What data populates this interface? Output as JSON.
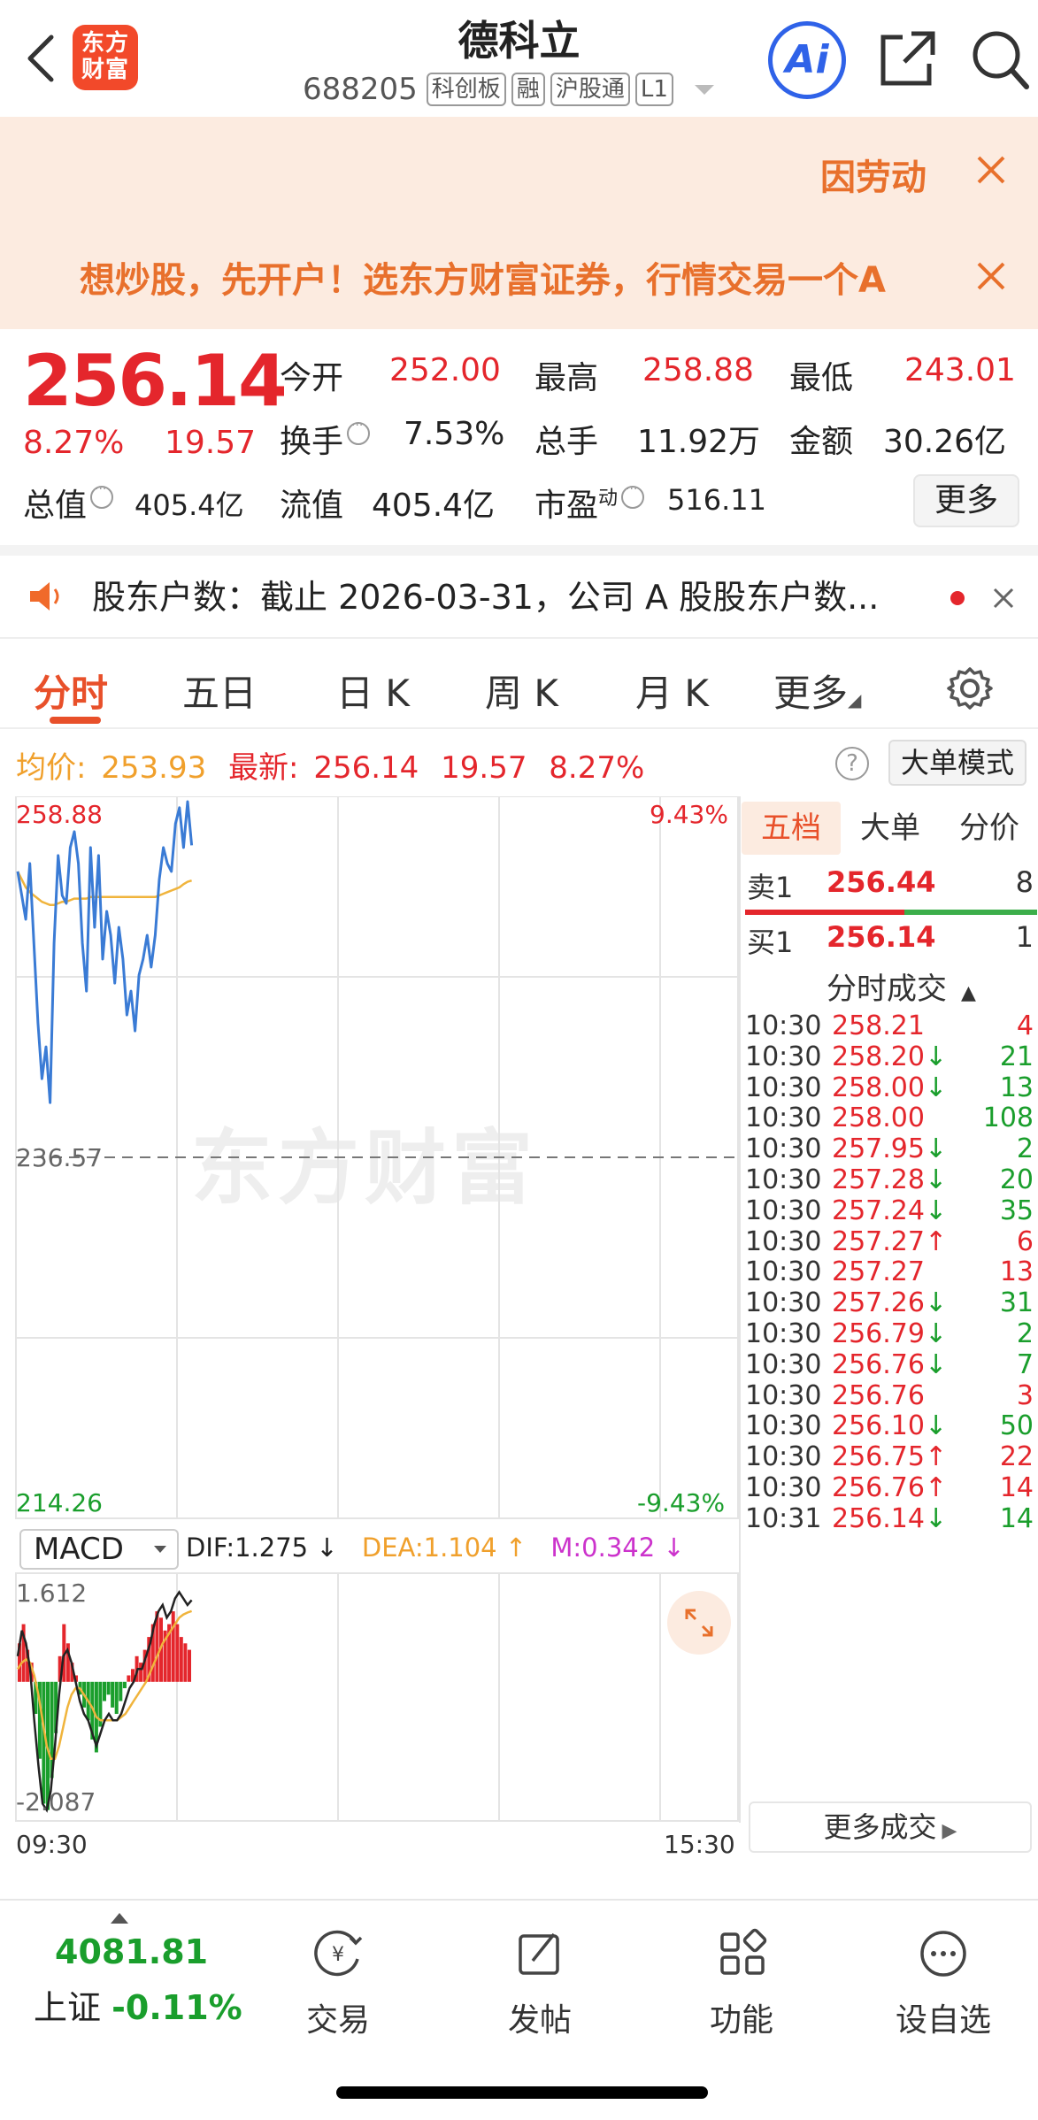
{
  "header": {
    "logo_text": "东方\n财富",
    "stock_name": "德科立",
    "stock_code": "688205",
    "tags": [
      "科创板",
      "融",
      "沪股通",
      "L1"
    ],
    "ai_label": "Ai"
  },
  "banners": {
    "banner1": "因劳动",
    "banner2": "想炒股，先开户！选东方财富证券，行情交易一个A"
  },
  "quote": {
    "price": "256.14",
    "change_pct": "8.27%",
    "change": "19.57",
    "open_label": "今开",
    "open": "252.00",
    "high_label": "最高",
    "high": "258.88",
    "low_label": "最低",
    "low": "243.01",
    "turnover_label": "换手",
    "turnover": "7.53%",
    "volume_label": "总手",
    "volume": "11.92万",
    "amount_label": "金额",
    "amount": "30.26亿",
    "mktcap_label": "总值",
    "mktcap": "405.4亿",
    "float_label": "流值",
    "float": "405.4亿",
    "pe_label": "市盈",
    "pe_sup": "动",
    "pe": "516.11",
    "more_label": "更多"
  },
  "notice": {
    "text": "股东户数：截止 2026-03-31，公司 A 股股东户数..."
  },
  "tabs": [
    "分时",
    "五日",
    "日 K",
    "周 K",
    "月 K",
    "更多"
  ],
  "chart_header": {
    "avg_label": "均价:",
    "avg": "253.93",
    "last_label": "最新:",
    "last": "256.14",
    "last_change": "19.57",
    "last_pct": "8.27%",
    "help_icon": "?",
    "mode_button": "大单模式"
  },
  "chart_data": {
    "type": "line",
    "title": "",
    "y_top": "258.88",
    "y_mid": "236.57",
    "y_bottom": "214.26",
    "pct_top": "9.43%",
    "pct_bottom": "-9.43%",
    "ylim": [
      214.26,
      258.88
    ],
    "x_start": "09:30",
    "x_end": "15:30",
    "watermark": "东方财富",
    "series": [
      {
        "values": [
          254.5,
          253.0,
          251.5,
          255.0,
          250.0,
          245.0,
          241.5,
          243.5,
          240.0,
          250.0,
          255.5,
          253.0,
          252.5,
          256.0,
          257.0,
          255.0,
          250.0,
          247.0,
          256.0,
          251.0,
          255.5,
          249.0,
          252.0,
          250.5,
          247.5,
          251.0,
          249.0,
          245.5,
          247.0,
          244.5,
          248.0,
          249.0,
          250.5,
          248.5,
          250.5,
          254.0,
          256.0,
          255.0,
          254.5,
          257.5,
          258.5,
          256.0,
          258.88,
          256.14
        ]
      },
      {
        "values": [
          254.5,
          254.0,
          253.5,
          253.2,
          253.0,
          252.8,
          252.6,
          252.5,
          252.4,
          252.4,
          252.5,
          252.6,
          252.6,
          252.7,
          252.8,
          252.8,
          252.8,
          252.8,
          252.9,
          252.9,
          252.9,
          252.9,
          252.9,
          252.9,
          252.9,
          252.9,
          252.9,
          252.9,
          252.9,
          252.9,
          252.9,
          252.9,
          252.9,
          252.9,
          252.9,
          253.0,
          253.1,
          253.2,
          253.3,
          253.4,
          253.5,
          253.7,
          253.85,
          253.93
        ]
      }
    ],
    "macd": {
      "indicator": "MACD",
      "dif_label": "DIF:1.275",
      "dea_label": "DEA:1.104",
      "m_label": "M:0.342",
      "y_top": "1.612",
      "y_bottom": "-2.087",
      "ylim": [
        -2.087,
        1.612
      ],
      "bars": [
        0.6,
        0.9,
        0.5,
        0.3,
        -0.5,
        -1.2,
        -1.9,
        -2.0,
        -1.5,
        -0.8,
        0.4,
        0.9,
        0.6,
        0.3,
        0.1,
        -0.2,
        -0.4,
        -0.6,
        -0.9,
        -1.1,
        -0.7,
        -0.3,
        -0.2,
        -0.4,
        -0.5,
        -0.3,
        -0.1,
        0.1,
        0.2,
        0.4,
        0.3,
        0.5,
        0.7,
        0.9,
        1.1,
        1.0,
        0.8,
        0.9,
        1.1,
        0.9,
        0.7,
        0.6,
        0.5
      ],
      "dif": [
        0.4,
        0.8,
        0.6,
        0.2,
        -0.6,
        -1.3,
        -1.9,
        -2.0,
        -1.7,
        -1.0,
        -0.2,
        0.4,
        0.5,
        0.3,
        0.0,
        -0.3,
        -0.5,
        -0.6,
        -0.8,
        -1.0,
        -0.8,
        -0.6,
        -0.5,
        -0.6,
        -0.6,
        -0.5,
        -0.3,
        -0.1,
        0.0,
        0.2,
        0.2,
        0.4,
        0.6,
        0.9,
        1.1,
        1.2,
        1.0,
        1.1,
        1.3,
        1.4,
        1.3,
        1.2,
        1.275
      ],
      "dea": [
        0.2,
        0.3,
        0.35,
        0.3,
        0.1,
        -0.2,
        -0.6,
        -1.0,
        -1.2,
        -1.2,
        -1.0,
        -0.7,
        -0.4,
        -0.2,
        -0.1,
        -0.1,
        -0.2,
        -0.3,
        -0.4,
        -0.55,
        -0.6,
        -0.6,
        -0.6,
        -0.6,
        -0.6,
        -0.55,
        -0.5,
        -0.4,
        -0.3,
        -0.2,
        -0.1,
        0.0,
        0.15,
        0.3,
        0.45,
        0.6,
        0.7,
        0.8,
        0.9,
        1.0,
        1.05,
        1.08,
        1.104
      ]
    }
  },
  "side_panel": {
    "tabs": [
      "五档",
      "大单",
      "分价"
    ],
    "sell1_label": "卖1",
    "sell1_price": "256.44",
    "sell1_vol": "8",
    "buy1_label": "买1",
    "buy1_price": "256.14",
    "buy1_vol": "1",
    "ticks_title": "分时成交",
    "ticks": [
      {
        "time": "10:30",
        "price": "258.21",
        "arrow": "",
        "vol": "4",
        "color": "red"
      },
      {
        "time": "10:30",
        "price": "258.20",
        "arrow": "↓",
        "vol": "21",
        "color": "green"
      },
      {
        "time": "10:30",
        "price": "258.00",
        "arrow": "↓",
        "vol": "13",
        "color": "green"
      },
      {
        "time": "10:30",
        "price": "258.00",
        "arrow": "",
        "vol": "108",
        "color": "green"
      },
      {
        "time": "10:30",
        "price": "257.95",
        "arrow": "↓",
        "vol": "2",
        "color": "green"
      },
      {
        "time": "10:30",
        "price": "257.28",
        "arrow": "↓",
        "vol": "20",
        "color": "green"
      },
      {
        "time": "10:30",
        "price": "257.24",
        "arrow": "↓",
        "vol": "35",
        "color": "green"
      },
      {
        "time": "10:30",
        "price": "257.27",
        "arrow": "↑",
        "vol": "6",
        "color": "red"
      },
      {
        "time": "10:30",
        "price": "257.27",
        "arrow": "",
        "vol": "13",
        "color": "red"
      },
      {
        "time": "10:30",
        "price": "257.26",
        "arrow": "↓",
        "vol": "31",
        "color": "green"
      },
      {
        "time": "10:30",
        "price": "256.79",
        "arrow": "↓",
        "vol": "2",
        "color": "green"
      },
      {
        "time": "10:30",
        "price": "256.76",
        "arrow": "↓",
        "vol": "7",
        "color": "green"
      },
      {
        "time": "10:30",
        "price": "256.76",
        "arrow": "",
        "vol": "3",
        "color": "red"
      },
      {
        "time": "10:30",
        "price": "256.10",
        "arrow": "↓",
        "vol": "50",
        "color": "green"
      },
      {
        "time": "10:30",
        "price": "256.75",
        "arrow": "↑",
        "vol": "22",
        "color": "red"
      },
      {
        "time": "10:30",
        "price": "256.76",
        "arrow": "↑",
        "vol": "14",
        "color": "red"
      },
      {
        "time": "10:31",
        "price": "256.14",
        "arrow": "↓",
        "vol": "14",
        "color": "green"
      }
    ],
    "more_ticks": "更多成交"
  },
  "bottom_nav": {
    "index_value": "4081.81",
    "index_name": "上证",
    "index_change": "-0.11%",
    "items": [
      {
        "label": "交易",
        "icon": "trade-icon"
      },
      {
        "label": "发帖",
        "icon": "post-icon"
      },
      {
        "label": "功能",
        "icon": "apps-icon"
      },
      {
        "label": "设自选",
        "icon": "more-dots-icon"
      }
    ]
  },
  "colors": {
    "up": "#e4262c",
    "down": "#1a9e2c",
    "accent": "#e8502a",
    "avg_line": "#f0b43c",
    "price_line": "#3a7bd5"
  }
}
